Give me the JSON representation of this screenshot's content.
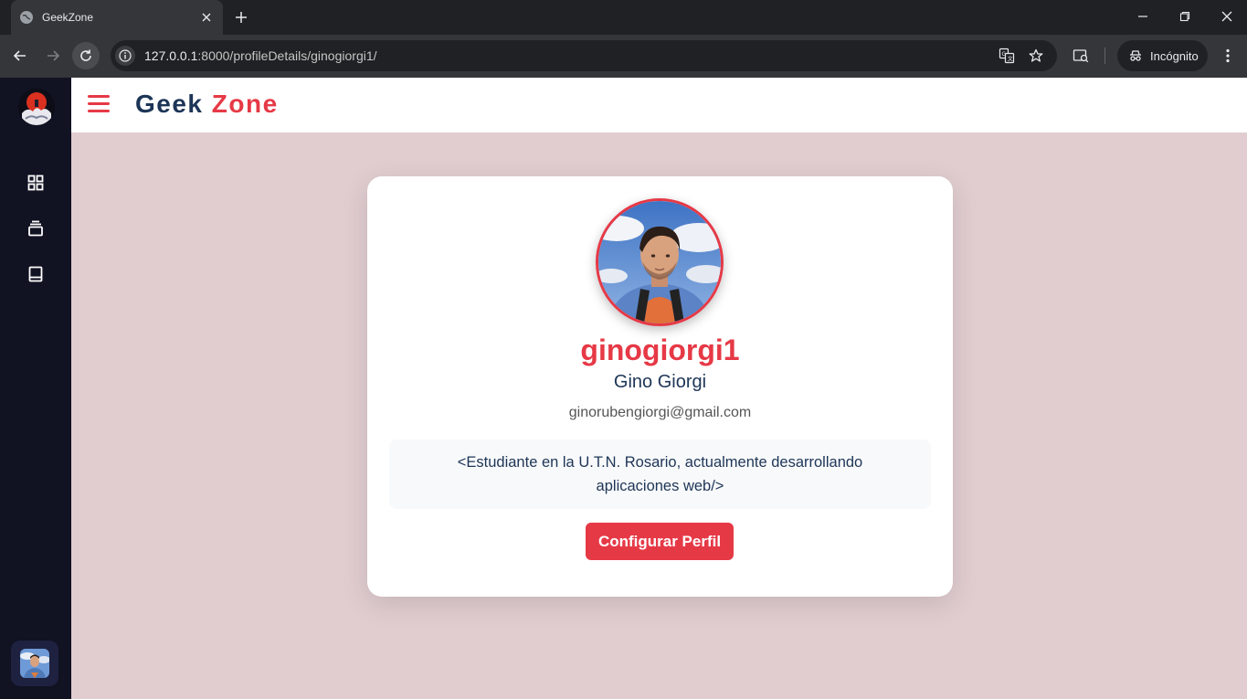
{
  "browser": {
    "tab_title": "GeekZone",
    "url_host": "127.0.0.1",
    "url_rest": ":8000/profileDetails/ginogiorgi1/",
    "incognito_label": "Incógnito"
  },
  "app": {
    "brand_part1": "Geek",
    "brand_part2": "Zone"
  },
  "sidebar": {
    "items": [
      {
        "icon": "grid-icon"
      },
      {
        "icon": "layers-icon"
      },
      {
        "icon": "book-icon"
      }
    ]
  },
  "profile": {
    "username": "ginogiorgi1",
    "full_name": "Gino Giorgi",
    "email": "ginorubengiorgi@gmail.com",
    "bio": "<Estudiante en la U.T.N. Rosario, actualmente desarrollando aplicaciones web/>",
    "configure_button": "Configurar Perfil"
  },
  "colors": {
    "accent": "#e63946",
    "navy": "#1d3557",
    "page_bg": "#e1cdcf",
    "sidebar_bg": "#111222"
  }
}
